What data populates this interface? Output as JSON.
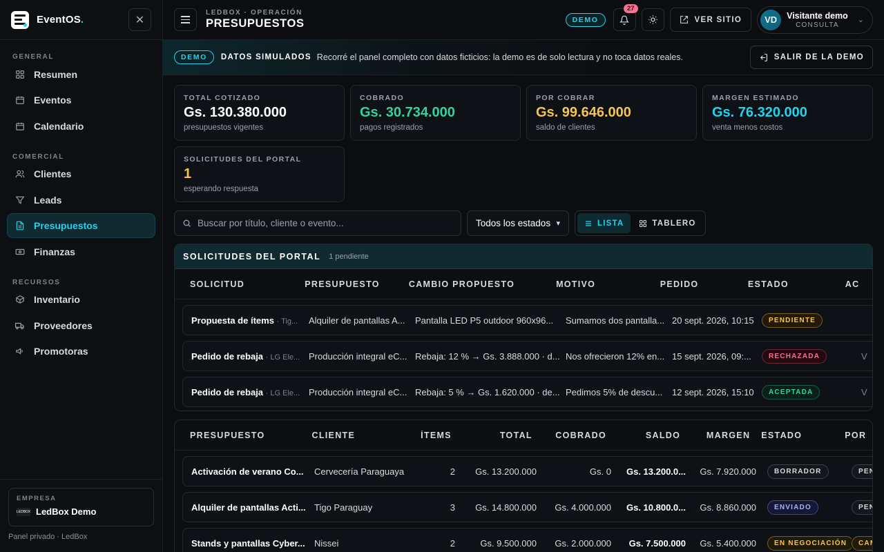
{
  "sidebar": {
    "brand": "EventOS",
    "brand_dot": ".",
    "sections": [
      {
        "title": "GENERAL",
        "items": [
          {
            "label": "Resumen",
            "icon": "grid-icon"
          },
          {
            "label": "Eventos",
            "icon": "calendar-icon"
          },
          {
            "label": "Calendario",
            "icon": "calendar-days-icon"
          }
        ]
      },
      {
        "title": "COMERCIAL",
        "items": [
          {
            "label": "Clientes",
            "icon": "users-icon"
          },
          {
            "label": "Leads",
            "icon": "filter-icon"
          },
          {
            "label": "Presupuestos",
            "icon": "document-icon",
            "active": true
          },
          {
            "label": "Finanzas",
            "icon": "banknote-icon"
          }
        ]
      },
      {
        "title": "RECURSOS",
        "items": [
          {
            "label": "Inventario",
            "icon": "box-icon"
          },
          {
            "label": "Proveedores",
            "icon": "truck-icon"
          },
          {
            "label": "Promotoras",
            "icon": "megaphone-icon"
          }
        ]
      }
    ],
    "company_label": "EMPRESA",
    "company_logo_text": "LEDBOX",
    "company_name": "LedBox Demo",
    "footer_note": "Panel privado · LedBox"
  },
  "topbar": {
    "crumb": "LEDBOX · OPERACIÓN",
    "title": "PRESUPUESTOS",
    "demo_label": "DEMO",
    "notifications": "27",
    "site_label": "VER SITIO",
    "user_initials": "VD",
    "user_name": "Visitante demo",
    "user_role": "CONSULTA"
  },
  "banner": {
    "pill": "DEMO",
    "strong": "DATOS SIMULADOS",
    "text": "Recorré el panel completo con datos ficticios: la demo es de solo lectura y no toca datos reales.",
    "exit_label": "SALIR DE LA DEMO"
  },
  "stats": [
    {
      "label": "TOTAL COTIZADO",
      "value": "Gs. 130.380.000",
      "note": "presupuestos vigentes",
      "color": "#ffffff"
    },
    {
      "label": "COBRADO",
      "value": "Gs. 30.734.000",
      "note": "pagos registrados",
      "color": "#34d399"
    },
    {
      "label": "POR COBRAR",
      "value": "Gs. 99.646.000",
      "note": "saldo de clientes",
      "color": "#f6c453"
    },
    {
      "label": "MARGEN ESTIMADO",
      "value": "Gs. 76.320.000",
      "note": "venta menos costos",
      "color": "#22d3ee"
    },
    {
      "label": "SOLICITUDES DEL PORTAL",
      "value": "1",
      "note": "esperando respuesta",
      "color": "#f6c453"
    }
  ],
  "filters": {
    "search_placeholder": "Buscar por título, cliente o evento...",
    "status_value": "Todos los estados",
    "view_list": "LISTA",
    "view_board": "TABLERO"
  },
  "portal": {
    "title": "SOLICITUDES DEL PORTAL",
    "count": "1 pendiente",
    "headers": [
      "SOLICITUD",
      "PRESUPUESTO",
      "CAMBIO PROPUESTO",
      "MOTIVO",
      "PEDIDO",
      "ESTADO",
      "AC"
    ],
    "rows": [
      {
        "solicitud": "Propuesta de ítems",
        "cliente": "· Tig...",
        "presupuesto": "Alquiler de pantallas A...",
        "cambio": "Pantalla LED P5 outdoor 960x96...",
        "motivo": "Sumamos dos pantalla...",
        "pedido": "20 sept. 2026, 10:15",
        "estado": "PENDIENTE",
        "estado_class": "p-yellow",
        "accion": ""
      },
      {
        "solicitud": "Pedido de rebaja",
        "cliente": "· LG Ele...",
        "presupuesto": "Producción integral eC...",
        "cambio": "Rebaja: 12 % → Gs. 3.888.000 · d...",
        "motivo": "Nos ofrecieron 12% en...",
        "pedido": "15 sept. 2026, 09:...",
        "estado": "RECHAZADA",
        "estado_class": "p-red",
        "accion": "V"
      },
      {
        "solicitud": "Pedido de rebaja",
        "cliente": "· LG Ele...",
        "presupuesto": "Producción integral eC...",
        "cambio": "Rebaja: 5 % → Gs. 1.620.000 · de...",
        "motivo": "Pedimos 5% de descu...",
        "pedido": "12 sept. 2026, 15:10",
        "estado": "ACEPTADA",
        "estado_class": "p-green",
        "accion": "V"
      }
    ]
  },
  "budgets": {
    "headers": [
      "PRESUPUESTO",
      "CLIENTE",
      "ÍTEMS",
      "TOTAL",
      "COBRADO",
      "SALDO",
      "MARGEN",
      "ESTADO",
      "POR"
    ],
    "rows": [
      {
        "presupuesto": "Activación de verano Co...",
        "cliente": "Cervecería Paraguaya",
        "items": "2",
        "total": "Gs. 13.200.000",
        "cobrado": "Gs. 0",
        "saldo": "Gs. 13.200.0...",
        "margen": "Gs. 7.920.000",
        "estado": "BORRADOR",
        "estado_class": "p-gray",
        "por": "PEN",
        "por_class": "p-gray"
      },
      {
        "presupuesto": "Alquiler de pantallas Acti...",
        "cliente": "Tigo Paraguay",
        "items": "3",
        "total": "Gs. 14.800.000",
        "cobrado": "Gs. 4.000.000",
        "saldo": "Gs. 10.800.0...",
        "margen": "Gs. 8.860.000",
        "estado": "ENVIADO",
        "estado_class": "p-blue",
        "por": "PEN",
        "por_class": "p-gray"
      },
      {
        "presupuesto": "Stands y pantallas Cyber...",
        "cliente": "Nissei",
        "items": "2",
        "total": "Gs. 9.500.000",
        "cobrado": "Gs. 2.000.000",
        "saldo": "Gs. 7.500.000",
        "margen": "Gs. 5.400.000",
        "estado": "EN NEGOCIACIÓN",
        "estado_class": "p-yellow",
        "por": "CAM",
        "por_class": "p-yellow"
      }
    ]
  }
}
